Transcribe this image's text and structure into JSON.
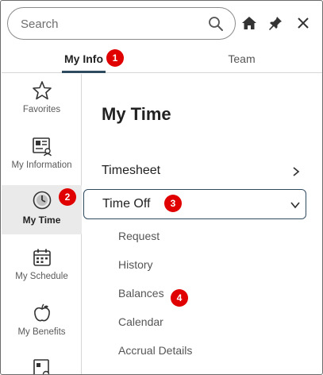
{
  "search": {
    "placeholder": "Search"
  },
  "tabs": [
    {
      "label": "My Info",
      "active": true
    },
    {
      "label": "Team",
      "active": false
    }
  ],
  "badges": [
    "1",
    "2",
    "3",
    "4"
  ],
  "sidebar": {
    "items": [
      {
        "label": "Favorites",
        "icon": "star-icon"
      },
      {
        "label": "My Information",
        "icon": "id-card-icon"
      },
      {
        "label": "My Time",
        "icon": "clock-icon",
        "active": true
      },
      {
        "label": "My Schedule",
        "icon": "calendar-icon"
      },
      {
        "label": "My Benefits",
        "icon": "apple-icon"
      }
    ]
  },
  "main": {
    "title": "My Time",
    "timesheet": "Timesheet",
    "time_off": "Time Off",
    "sub_items": [
      "Request",
      "History",
      "Balances",
      "Calendar",
      "Accrual Details"
    ]
  },
  "colors": {
    "accent": "#2f4b60",
    "badge": "#e00000",
    "active_bg": "#eaeaea"
  }
}
